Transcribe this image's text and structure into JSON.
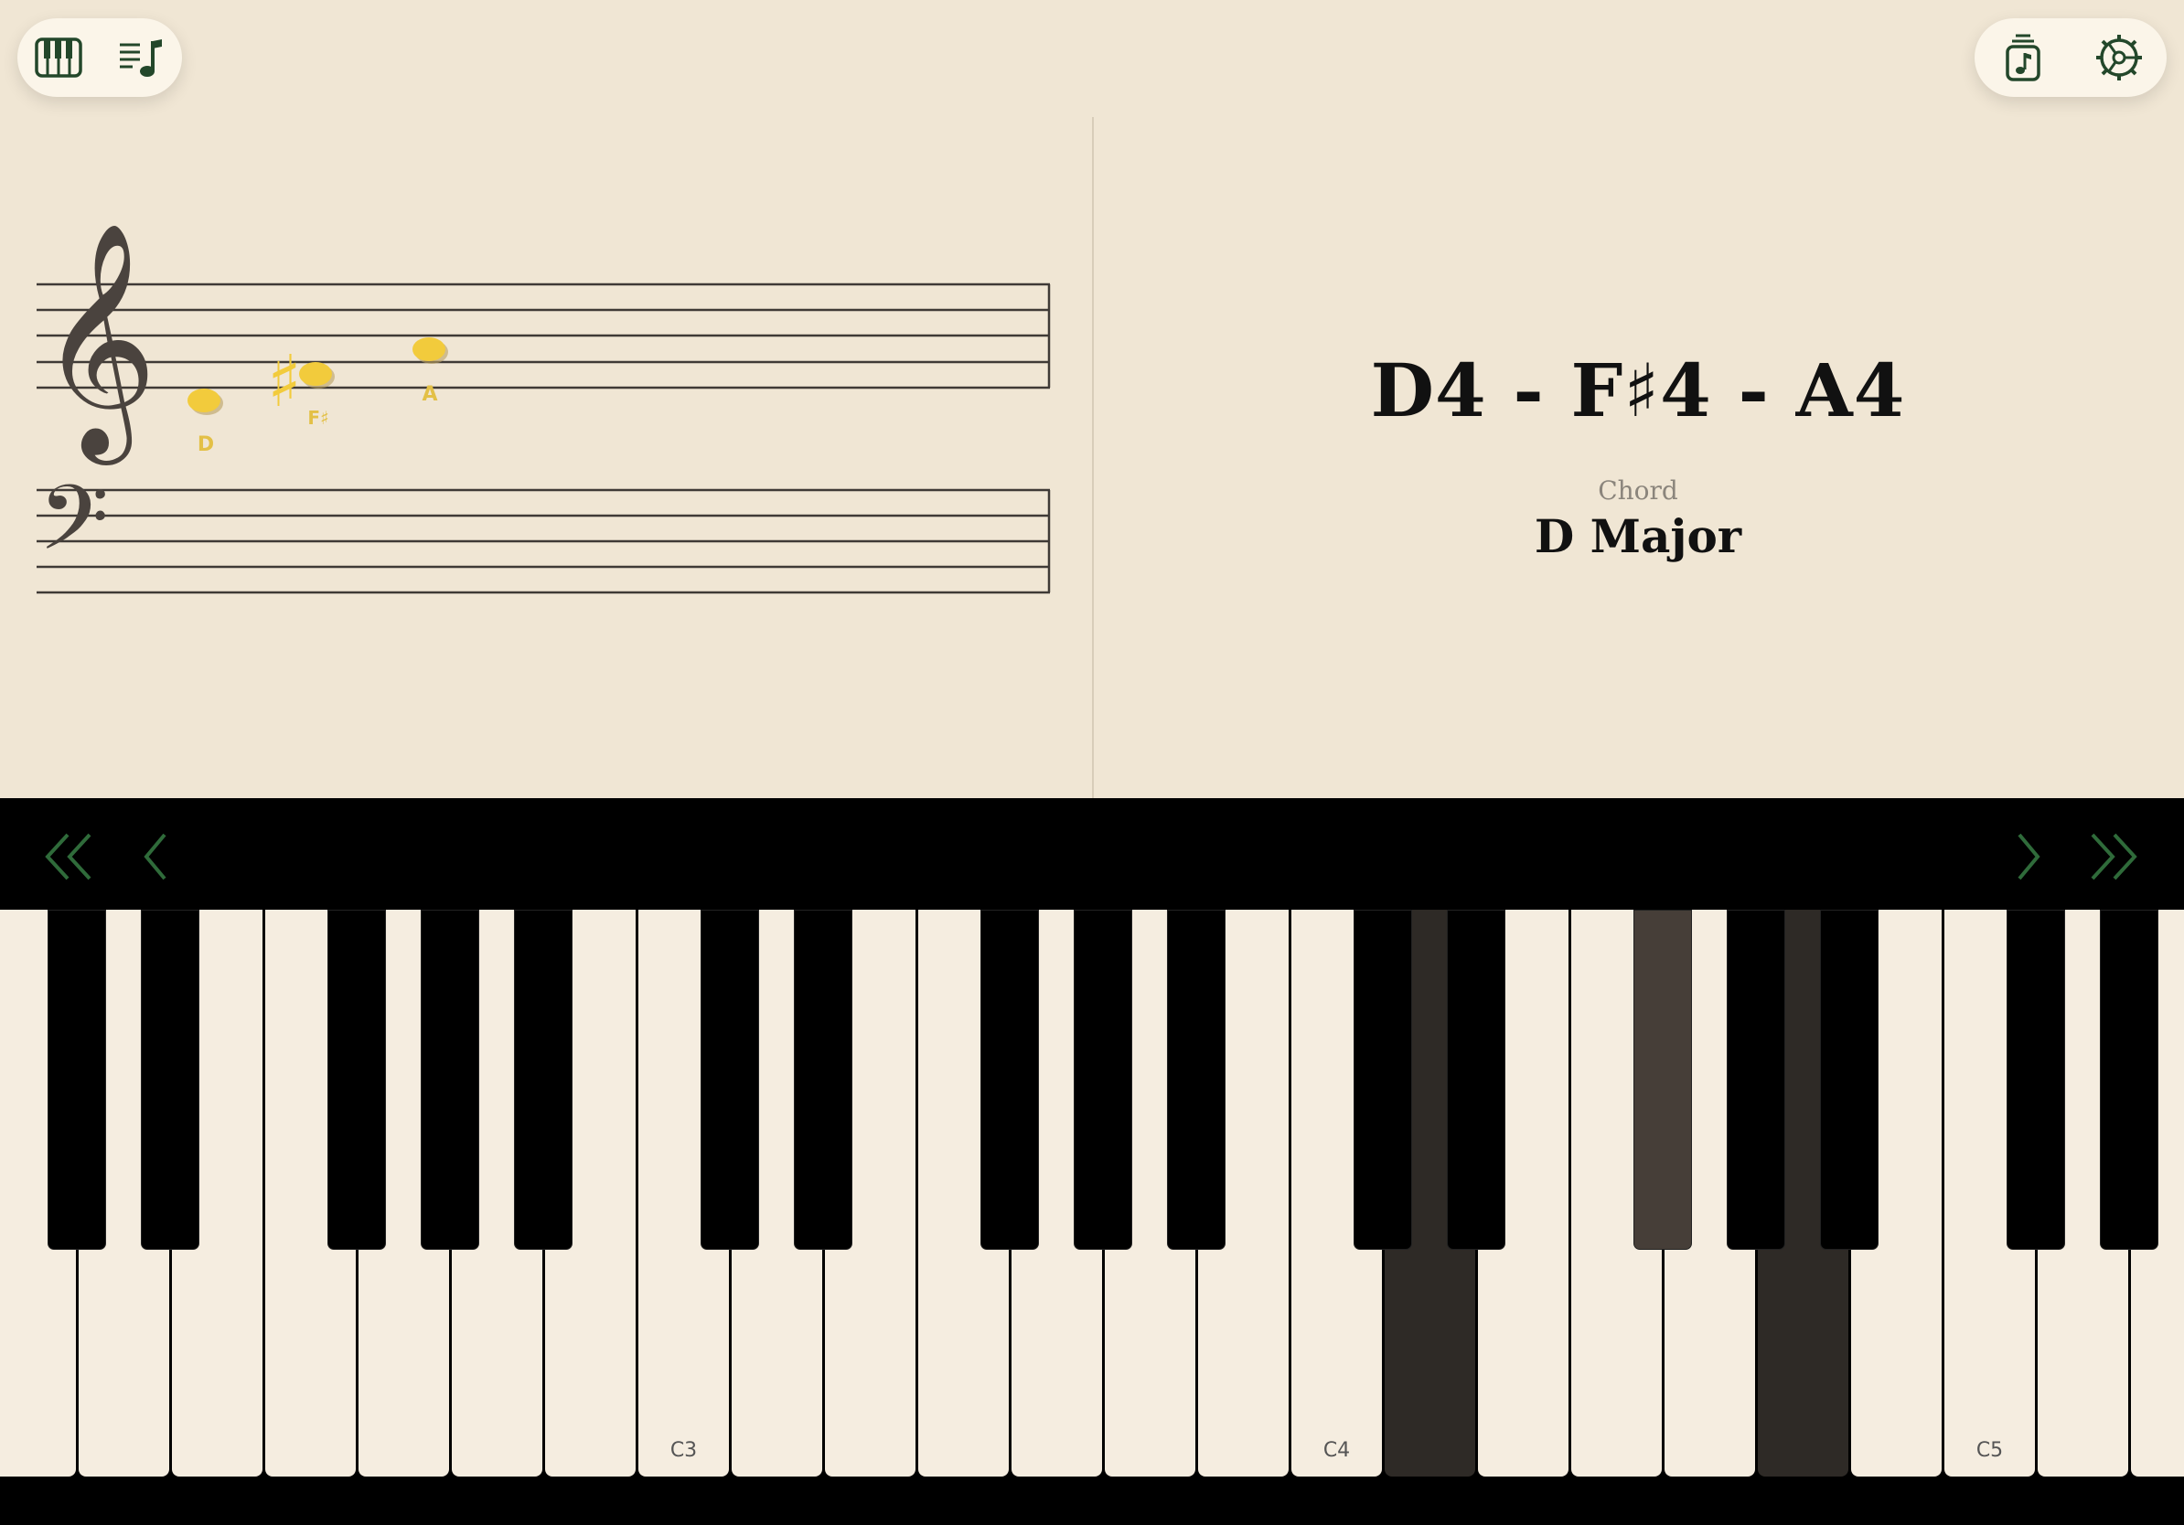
{
  "toolbar": {
    "left_buttons": [
      {
        "name": "piano-icon",
        "label": "Piano"
      },
      {
        "name": "song-list-icon",
        "label": "Song list"
      }
    ],
    "right_buttons": [
      {
        "name": "music-library-icon",
        "label": "Music library"
      },
      {
        "name": "settings-icon",
        "label": "Settings"
      }
    ]
  },
  "staff": {
    "notes": [
      {
        "label": "D",
        "color": "#f2cb3c"
      },
      {
        "label": "F♯",
        "color": "#f2cb3c"
      },
      {
        "label": "A",
        "color": "#f2cb3c"
      }
    ],
    "sharp_symbol": "♯"
  },
  "display": {
    "notes_text": "D4 - F♯4 - A4",
    "chord_label": "Chord",
    "chord_name": "D Major"
  },
  "navigation": {
    "first": "«",
    "previous": "‹",
    "next": "›",
    "last": "»",
    "accent_color": "#2f6b3a"
  },
  "keyboard": {
    "octave_labels": [
      "C3",
      "C4",
      "C5"
    ],
    "active_notes": [
      "D4",
      "F♯4",
      "A4"
    ]
  }
}
